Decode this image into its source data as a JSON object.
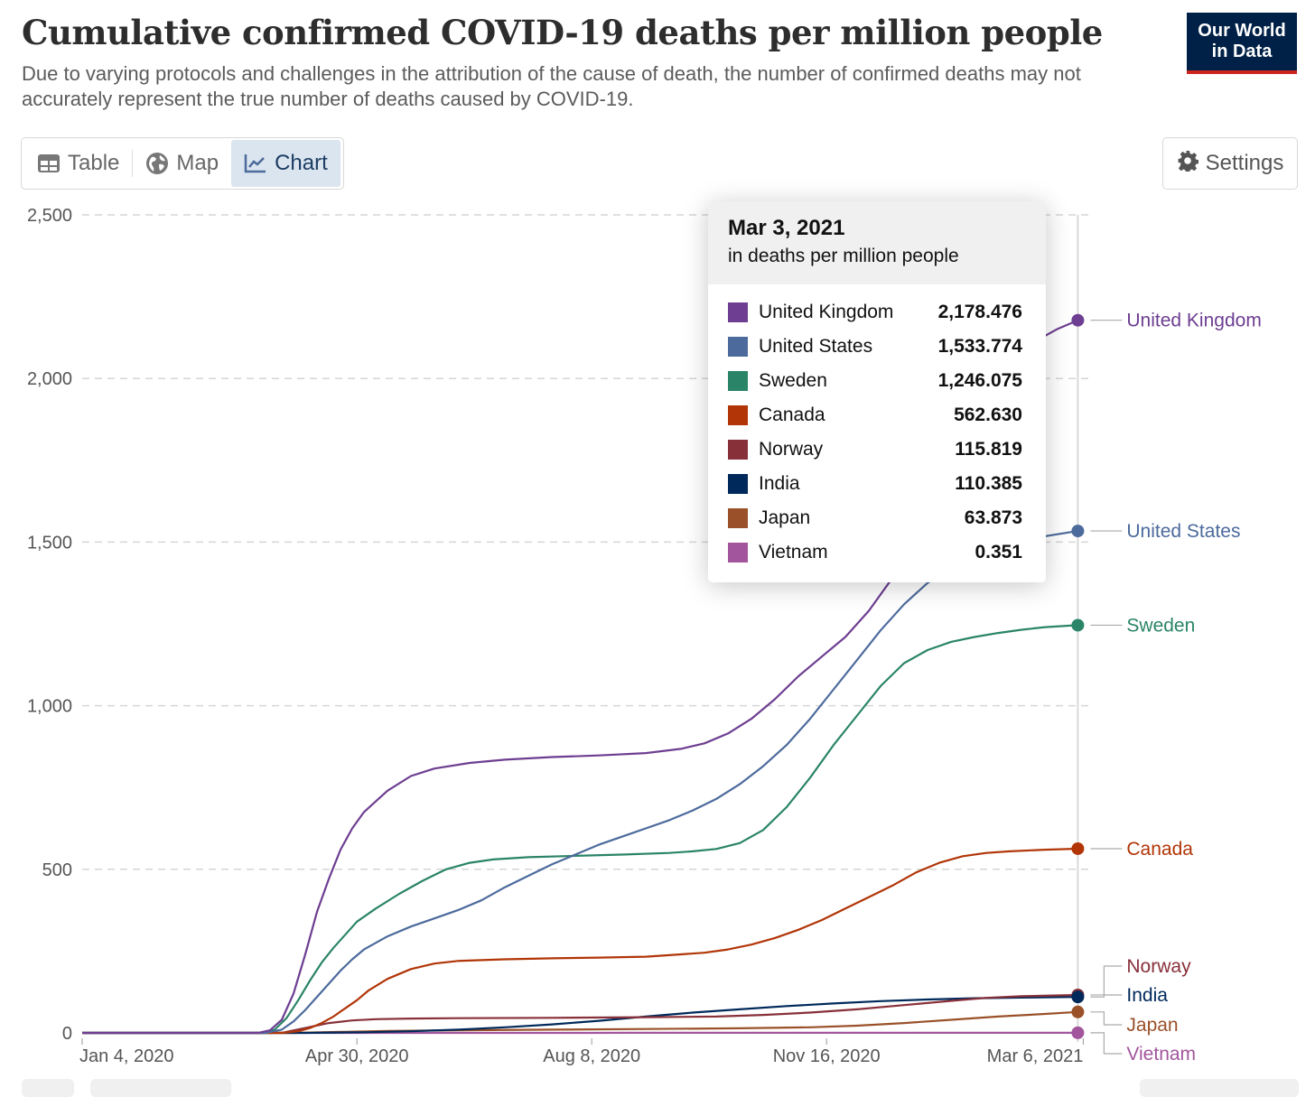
{
  "header": {
    "title": "Cumulative confirmed COVID-19 deaths per million people",
    "subtitle": "Due to varying protocols and challenges in the attribution of the cause of death, the number of confirmed deaths may not accurately represent the true number of deaths caused by COVID-19.",
    "logo_line1": "Our World",
    "logo_line2": "in Data"
  },
  "tabs": [
    {
      "label": "Table",
      "icon": "table-icon",
      "active": false
    },
    {
      "label": "Map",
      "icon": "globe-icon",
      "active": false
    },
    {
      "label": "Chart",
      "icon": "line-chart-icon",
      "active": true
    }
  ],
  "settings": {
    "label": "Settings",
    "icon": "gear-icon"
  },
  "tooltip": {
    "date": "Mar 3, 2021",
    "unit": "in deaths per million people",
    "rows": [
      {
        "name": "United Kingdom",
        "value": "2,178.476",
        "color": "#6d3e91"
      },
      {
        "name": "United States",
        "value": "1,533.774",
        "color": "#4c6a9c"
      },
      {
        "name": "Sweden",
        "value": "1,246.075",
        "color": "#2a8467"
      },
      {
        "name": "Canada",
        "value": "562.630",
        "color": "#b13507"
      },
      {
        "name": "Norway",
        "value": "115.819",
        "color": "#883039"
      },
      {
        "name": "India",
        "value": "110.385",
        "color": "#00295b"
      },
      {
        "name": "Japan",
        "value": "63.873",
        "color": "#9a5129"
      },
      {
        "name": "Vietnam",
        "value": "0.351",
        "color": "#a2559c"
      }
    ]
  },
  "chart_data": {
    "type": "line",
    "title": "Cumulative confirmed COVID-19 deaths per million people",
    "xlabel": "",
    "ylabel": "",
    "x_unit": "days since Jan 4, 2020",
    "x_range": [
      0,
      424
    ],
    "ylim": [
      0,
      2500
    ],
    "y_ticks": [
      0,
      500,
      1000,
      1500,
      2000,
      2500
    ],
    "y_tick_labels": [
      "0",
      "500",
      "1,000",
      "1,500",
      "2,000",
      "2,500"
    ],
    "x_ticks": [
      0,
      117,
      217,
      317,
      427
    ],
    "x_tick_labels": [
      "Jan 4, 2020",
      "Apr 30, 2020",
      "Aug 8, 2020",
      "Nov 16, 2020",
      "Mar 6, 2021"
    ],
    "grid": "horizontal-dashed",
    "legend": "right-end-labels",
    "series": [
      {
        "name": "United Kingdom",
        "color": "#6d3e91",
        "points": [
          [
            0,
            0
          ],
          [
            75,
            0
          ],
          [
            80,
            8
          ],
          [
            85,
            40
          ],
          [
            90,
            120
          ],
          [
            95,
            240
          ],
          [
            100,
            370
          ],
          [
            105,
            470
          ],
          [
            110,
            560
          ],
          [
            115,
            625
          ],
          [
            120,
            675
          ],
          [
            130,
            740
          ],
          [
            140,
            785
          ],
          [
            150,
            808
          ],
          [
            165,
            825
          ],
          [
            180,
            835
          ],
          [
            200,
            843
          ],
          [
            220,
            848
          ],
          [
            240,
            855
          ],
          [
            255,
            868
          ],
          [
            265,
            885
          ],
          [
            275,
            915
          ],
          [
            285,
            960
          ],
          [
            295,
            1020
          ],
          [
            305,
            1090
          ],
          [
            315,
            1150
          ],
          [
            325,
            1210
          ],
          [
            335,
            1290
          ],
          [
            345,
            1390
          ],
          [
            355,
            1510
          ],
          [
            365,
            1650
          ],
          [
            375,
            1790
          ],
          [
            385,
            1920
          ],
          [
            395,
            2040
          ],
          [
            405,
            2110
          ],
          [
            415,
            2150
          ],
          [
            424,
            2178
          ]
        ]
      },
      {
        "name": "United States",
        "color": "#4c6a9c",
        "points": [
          [
            0,
            0
          ],
          [
            78,
            0
          ],
          [
            85,
            10
          ],
          [
            90,
            35
          ],
          [
            95,
            70
          ],
          [
            100,
            110
          ],
          [
            105,
            150
          ],
          [
            110,
            190
          ],
          [
            115,
            225
          ],
          [
            120,
            255
          ],
          [
            130,
            295
          ],
          [
            140,
            325
          ],
          [
            150,
            350
          ],
          [
            160,
            375
          ],
          [
            170,
            405
          ],
          [
            180,
            445
          ],
          [
            190,
            480
          ],
          [
            200,
            515
          ],
          [
            210,
            545
          ],
          [
            220,
            575
          ],
          [
            230,
            600
          ],
          [
            240,
            625
          ],
          [
            250,
            650
          ],
          [
            260,
            680
          ],
          [
            270,
            715
          ],
          [
            280,
            760
          ],
          [
            290,
            815
          ],
          [
            300,
            880
          ],
          [
            310,
            960
          ],
          [
            320,
            1050
          ],
          [
            330,
            1140
          ],
          [
            340,
            1230
          ],
          [
            350,
            1310
          ],
          [
            360,
            1375
          ],
          [
            370,
            1420
          ],
          [
            380,
            1460
          ],
          [
            390,
            1490
          ],
          [
            400,
            1505
          ],
          [
            410,
            1518
          ],
          [
            424,
            1534
          ]
        ]
      },
      {
        "name": "Sweden",
        "color": "#2a8467",
        "points": [
          [
            0,
            0
          ],
          [
            77,
            0
          ],
          [
            82,
            10
          ],
          [
            87,
            45
          ],
          [
            92,
            100
          ],
          [
            97,
            160
          ],
          [
            102,
            215
          ],
          [
            107,
            260
          ],
          [
            112,
            300
          ],
          [
            117,
            340
          ],
          [
            125,
            380
          ],
          [
            135,
            425
          ],
          [
            145,
            465
          ],
          [
            155,
            500
          ],
          [
            165,
            520
          ],
          [
            175,
            530
          ],
          [
            190,
            537
          ],
          [
            210,
            541
          ],
          [
            230,
            545
          ],
          [
            250,
            550
          ],
          [
            260,
            555
          ],
          [
            270,
            562
          ],
          [
            280,
            580
          ],
          [
            290,
            620
          ],
          [
            300,
            690
          ],
          [
            310,
            780
          ],
          [
            320,
            880
          ],
          [
            330,
            970
          ],
          [
            340,
            1060
          ],
          [
            350,
            1130
          ],
          [
            360,
            1170
          ],
          [
            370,
            1195
          ],
          [
            380,
            1210
          ],
          [
            390,
            1222
          ],
          [
            400,
            1232
          ],
          [
            410,
            1240
          ],
          [
            424,
            1246
          ]
        ]
      },
      {
        "name": "Canada",
        "color": "#b13507",
        "points": [
          [
            0,
            0
          ],
          [
            85,
            0
          ],
          [
            92,
            5
          ],
          [
            97,
            15
          ],
          [
            102,
            30
          ],
          [
            107,
            50
          ],
          [
            112,
            75
          ],
          [
            117,
            100
          ],
          [
            122,
            130
          ],
          [
            130,
            165
          ],
          [
            140,
            195
          ],
          [
            150,
            212
          ],
          [
            160,
            220
          ],
          [
            180,
            225
          ],
          [
            200,
            228
          ],
          [
            220,
            230
          ],
          [
            240,
            233
          ],
          [
            255,
            240
          ],
          [
            265,
            245
          ],
          [
            275,
            255
          ],
          [
            285,
            270
          ],
          [
            295,
            290
          ],
          [
            305,
            315
          ],
          [
            315,
            345
          ],
          [
            325,
            380
          ],
          [
            335,
            415
          ],
          [
            345,
            450
          ],
          [
            355,
            490
          ],
          [
            365,
            520
          ],
          [
            375,
            540
          ],
          [
            385,
            550
          ],
          [
            395,
            555
          ],
          [
            410,
            560
          ],
          [
            424,
            563
          ]
        ]
      },
      {
        "name": "Norway",
        "color": "#883039",
        "points": [
          [
            0,
            0
          ],
          [
            85,
            0
          ],
          [
            95,
            15
          ],
          [
            105,
            30
          ],
          [
            115,
            38
          ],
          [
            125,
            42
          ],
          [
            140,
            44
          ],
          [
            160,
            45
          ],
          [
            200,
            46
          ],
          [
            240,
            48
          ],
          [
            270,
            50
          ],
          [
            290,
            55
          ],
          [
            310,
            62
          ],
          [
            330,
            72
          ],
          [
            350,
            85
          ],
          [
            370,
            98
          ],
          [
            385,
            107
          ],
          [
            400,
            112
          ],
          [
            424,
            116
          ]
        ]
      },
      {
        "name": "India",
        "color": "#00295b",
        "points": [
          [
            0,
            0
          ],
          [
            95,
            0
          ],
          [
            120,
            2
          ],
          [
            140,
            5
          ],
          [
            160,
            10
          ],
          [
            180,
            17
          ],
          [
            200,
            26
          ],
          [
            220,
            37
          ],
          [
            240,
            50
          ],
          [
            260,
            62
          ],
          [
            280,
            72
          ],
          [
            300,
            82
          ],
          [
            320,
            90
          ],
          [
            340,
            97
          ],
          [
            360,
            102
          ],
          [
            380,
            106
          ],
          [
            400,
            108
          ],
          [
            424,
            110
          ]
        ]
      },
      {
        "name": "Japan",
        "color": "#9a5129",
        "points": [
          [
            0,
            0
          ],
          [
            90,
            0
          ],
          [
            110,
            3
          ],
          [
            130,
            6
          ],
          [
            160,
            8
          ],
          [
            200,
            10
          ],
          [
            240,
            12
          ],
          [
            280,
            14
          ],
          [
            310,
            17
          ],
          [
            330,
            22
          ],
          [
            350,
            30
          ],
          [
            370,
            40
          ],
          [
            390,
            50
          ],
          [
            410,
            58
          ],
          [
            424,
            64
          ]
        ]
      },
      {
        "name": "Vietnam",
        "color": "#a2559c",
        "points": [
          [
            0,
            0
          ],
          [
            200,
            0
          ],
          [
            215,
            0.1
          ],
          [
            230,
            0.3
          ],
          [
            424,
            0.351
          ]
        ]
      }
    ]
  }
}
